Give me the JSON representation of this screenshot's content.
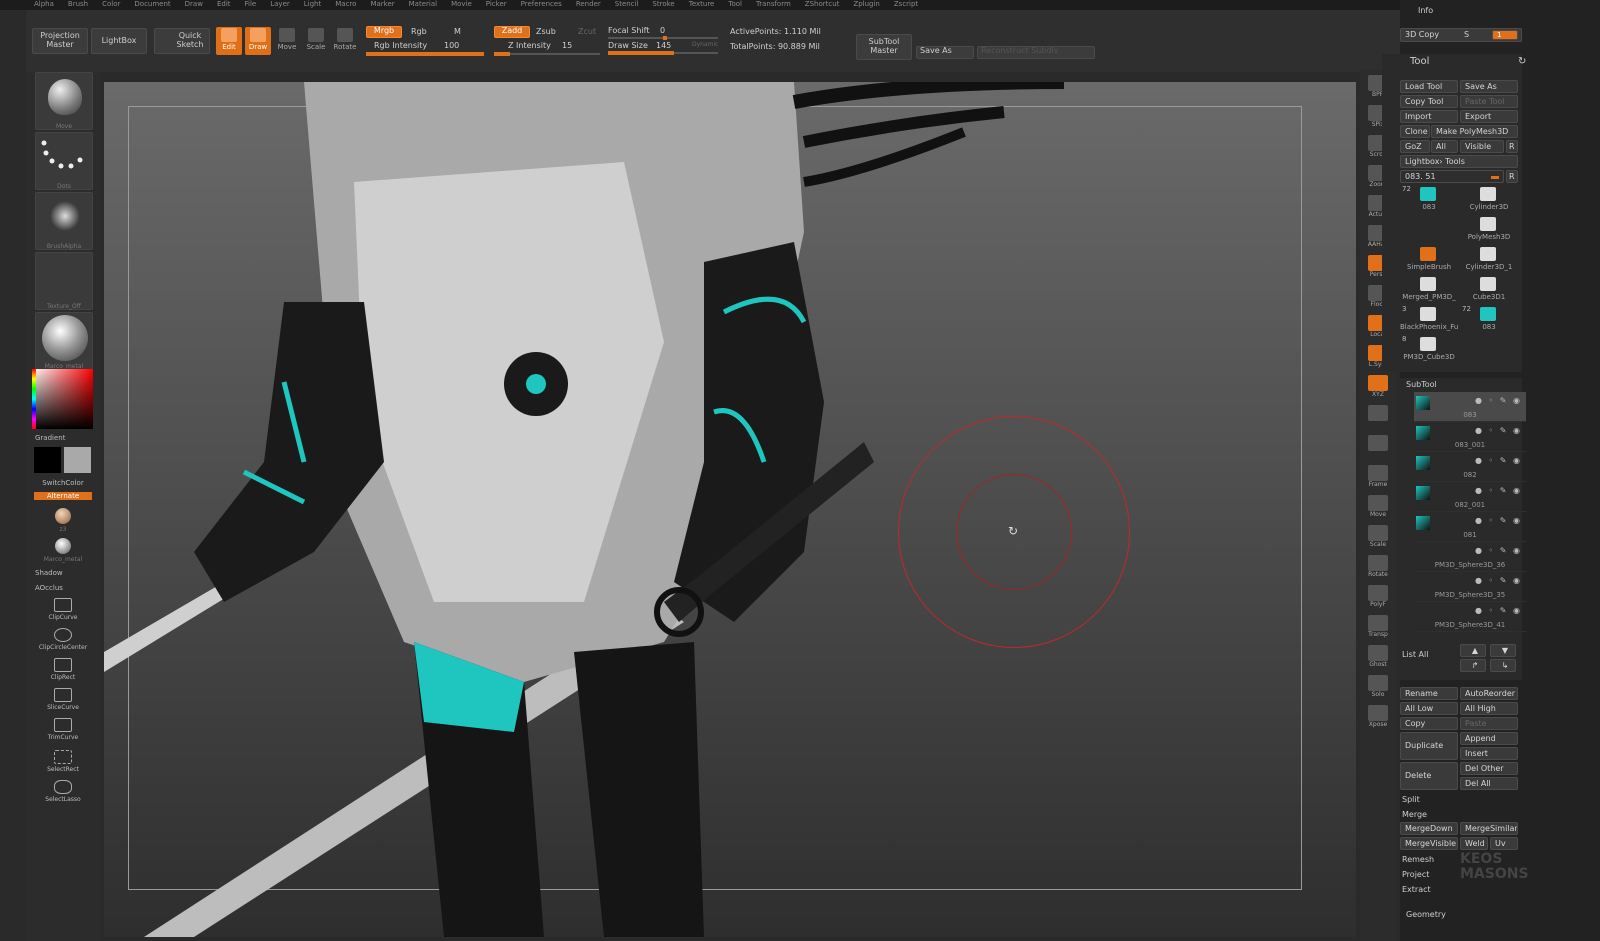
{
  "menubar": {
    "items": [
      "Alpha",
      "Brush",
      "Color",
      "Document",
      "Draw",
      "Edit",
      "File",
      "Layer",
      "Light",
      "Macro",
      "Marker",
      "Material",
      "Movie",
      "Picker",
      "Preferences",
      "Render",
      "Stencil",
      "Stroke",
      "Texture",
      "Tool",
      "Transform",
      "ZShortcut",
      "Zplugin",
      "Zscript"
    ]
  },
  "topbar": {
    "projection_master": "Projection Master",
    "lightbox": "LightBox",
    "quick_sketch": "Quick Sketch",
    "edit": "Edit",
    "draw": "Draw",
    "move": "Move",
    "scale": "Scale",
    "rotate": "Rotate",
    "mrgb": "Mrgb",
    "rgb": "Rgb",
    "m": "M",
    "rgb_intensity_label": "Rgb Intensity",
    "rgb_intensity_value": "100",
    "zadd": "Zadd",
    "zsub": "Zsub",
    "zcut": "Zcut",
    "z_intensity_label": "Z Intensity",
    "z_intensity_value": "15",
    "focal_shift_label": "Focal Shift",
    "focal_shift_value": "0",
    "draw_size_label": "Draw Size",
    "draw_size_value": "145",
    "dynamic": "Dynamic",
    "active_points": "ActivePoints: 1.110 Mil",
    "total_points": "TotalPoints: 90.889 Mil",
    "subtool_master": "SubTool Master",
    "save_as": "Save As",
    "reconstruct_subdiv": "Reconstruct Subdiv"
  },
  "leftshelf": {
    "brush": "Move",
    "stroke": "Dots",
    "alpha": "BrushAlpha",
    "texture": "Texture_Off",
    "material": "Marco_metal",
    "gradient": "Gradient",
    "switchcolor": "SwitchColor",
    "alternate": "Alternate",
    "mat1": "z3",
    "mat2": "Marco_metal",
    "shadow": "Shadow",
    "aocclus": "AOcclus",
    "tools": [
      "ClipCurve",
      "ClipCircleCenter",
      "ClipRect",
      "SliceCurve",
      "TrimCurve",
      "SelectRect",
      "SelectLasso"
    ]
  },
  "rightshelf": {
    "buttons": [
      "BPR",
      "SPix",
      "Scroll",
      "Zoom",
      "Actual",
      "AAHalf",
      "Persp",
      "Floor",
      "Local",
      "L.Sym",
      "XYZ",
      "",
      "",
      "Frame",
      "Move",
      "Scale",
      "Rotate",
      "PolyF",
      "Transp",
      "Ghost",
      "Solo",
      "Xpose"
    ]
  },
  "tray": {
    "info": "Info",
    "copy3d": "3D Copy",
    "copy3d_s": "S",
    "copy3d_val": "1",
    "tool_title": "Tool",
    "load_tool": "Load Tool",
    "save_as": "Save As",
    "copy_tool": "Copy Tool",
    "paste_tool": "Paste Tool",
    "import": "Import",
    "export": "Export",
    "clone": "Clone",
    "make_polymesh": "Make PolyMesh3D",
    "goz": "GoZ",
    "all": "All",
    "visible": "Visible",
    "r": "R",
    "lightbox_tools": "Lightbox› Tools",
    "tool_slider": "083. 51",
    "thumbs": [
      {
        "label": "083",
        "num": "72"
      },
      {
        "label": "Cylinder3D",
        "num": ""
      },
      {
        "label": "PolyMesh3D",
        "num": ""
      },
      {
        "label": "SimpleBrush",
        "num": ""
      },
      {
        "label": "Cylinder3D_1",
        "num": ""
      },
      {
        "label": "Merged_PM3D_",
        "num": ""
      },
      {
        "label": "Cube3D1",
        "num": ""
      },
      {
        "label": "BlackPhoenix_Fu",
        "num": "3"
      },
      {
        "label": "083",
        "num": "72"
      },
      {
        "label": "PM3D_Cube3D",
        "num": "8"
      }
    ],
    "subtool_title": "SubTool",
    "subtools": [
      "083",
      "083_001",
      "082",
      "082_001",
      "081",
      "PM3D_Sphere3D_36",
      "PM3D_Sphere3D_35",
      "PM3D_Sphere3D_41"
    ],
    "list_all": "List All",
    "rename": "Rename",
    "autoreorder": "AutoReorder",
    "all_low": "All Low",
    "all_high": "All High",
    "copy": "Copy",
    "paste": "Paste",
    "duplicate": "Duplicate",
    "append": "Append",
    "insert": "Insert",
    "delete": "Delete",
    "del_other": "Del Other",
    "del_all": "Del All",
    "split": "Split",
    "merge": "Merge",
    "mergedown": "MergeDown",
    "mergesimilar": "MergeSimilar",
    "mergevisible": "MergeVisible",
    "weld": "Weld",
    "uv": "Uv",
    "remesh": "Remesh",
    "project": "Project",
    "extract": "Extract",
    "geometry": "Geometry",
    "watermark": "KEOS MASONS"
  },
  "colors": {
    "accent": "#e0701a",
    "teal": "#1fc6c0",
    "brushcursor": "#c0282a"
  }
}
